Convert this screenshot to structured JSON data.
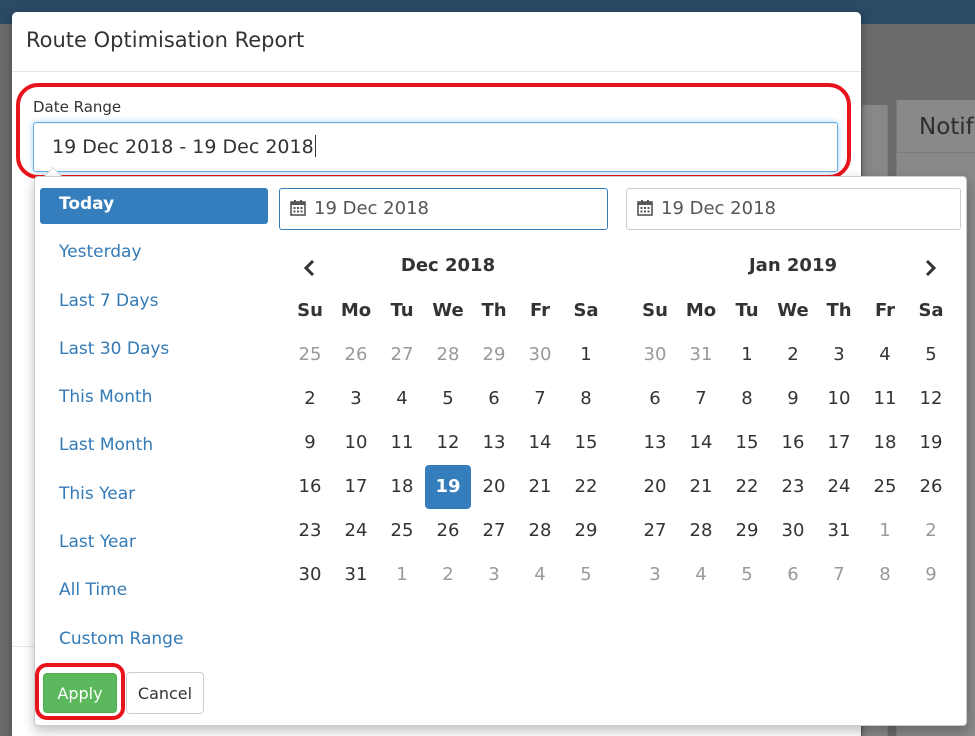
{
  "modal": {
    "title": "Route Optimisation Report",
    "date_label": "Date Range",
    "date_value": "19 Dec 2018 - 19 Dec 2018"
  },
  "background": {
    "right_panel_title": "Notif"
  },
  "picker": {
    "ranges": [
      "Today",
      "Yesterday",
      "Last 7 Days",
      "Last 30 Days",
      "This Month",
      "Last Month",
      "This Year",
      "Last Year",
      "All Time",
      "Custom Range"
    ],
    "active_range": "Today",
    "start_input": "19 Dec 2018",
    "end_input": "19 Dec 2018",
    "weekdays": [
      "Su",
      "Mo",
      "Tu",
      "We",
      "Th",
      "Fr",
      "Sa"
    ],
    "left_month": {
      "title": "Dec 2018",
      "weeks": [
        [
          "25",
          "26",
          "27",
          "28",
          "29",
          "30",
          "1"
        ],
        [
          "2",
          "3",
          "4",
          "5",
          "6",
          "7",
          "8"
        ],
        [
          "9",
          "10",
          "11",
          "12",
          "13",
          "14",
          "15"
        ],
        [
          "16",
          "17",
          "18",
          "19",
          "20",
          "21",
          "22"
        ],
        [
          "23",
          "24",
          "25",
          "26",
          "27",
          "28",
          "29"
        ],
        [
          "30",
          "31",
          "1",
          "2",
          "3",
          "4",
          "5"
        ]
      ],
      "off": [
        [
          0,
          0
        ],
        [
          0,
          1
        ],
        [
          0,
          2
        ],
        [
          0,
          3
        ],
        [
          0,
          4
        ],
        [
          0,
          5
        ],
        [
          5,
          2
        ],
        [
          5,
          3
        ],
        [
          5,
          4
        ],
        [
          5,
          5
        ],
        [
          5,
          6
        ]
      ],
      "selected": [
        3,
        3
      ]
    },
    "right_month": {
      "title": "Jan 2019",
      "weeks": [
        [
          "30",
          "31",
          "1",
          "2",
          "3",
          "4",
          "5"
        ],
        [
          "6",
          "7",
          "8",
          "9",
          "10",
          "11",
          "12"
        ],
        [
          "13",
          "14",
          "15",
          "16",
          "17",
          "18",
          "19"
        ],
        [
          "20",
          "21",
          "22",
          "23",
          "24",
          "25",
          "26"
        ],
        [
          "27",
          "28",
          "29",
          "30",
          "31",
          "1",
          "2"
        ],
        [
          "3",
          "4",
          "5",
          "6",
          "7",
          "8",
          "9"
        ]
      ],
      "off": [
        [
          0,
          0
        ],
        [
          0,
          1
        ],
        [
          4,
          5
        ],
        [
          4,
          6
        ],
        [
          5,
          0
        ],
        [
          5,
          1
        ],
        [
          5,
          2
        ],
        [
          5,
          3
        ],
        [
          5,
          4
        ],
        [
          5,
          5
        ],
        [
          5,
          6
        ]
      ]
    },
    "apply_label": "Apply",
    "cancel_label": "Cancel"
  },
  "icons": {
    "prev": "chevron-left-icon",
    "next": "chevron-right-icon",
    "calendar": "calendar-icon"
  },
  "colors": {
    "primary": "#357ebd",
    "link": "#337ab7",
    "success": "#5cb85c",
    "highlight": "#e8141b",
    "top_bar": "#2b4a66"
  }
}
